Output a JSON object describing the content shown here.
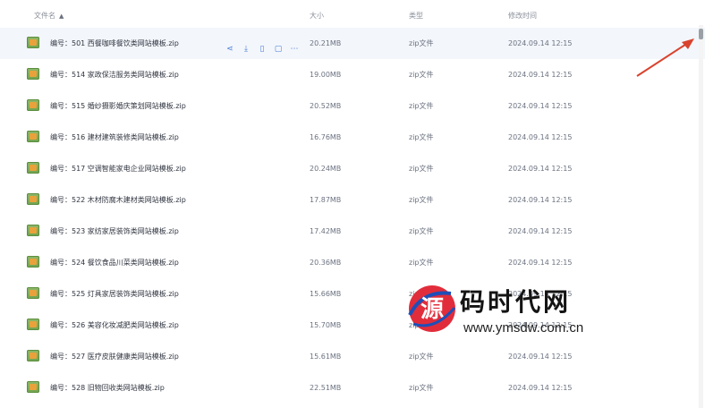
{
  "table": {
    "headers": {
      "name": "文件名",
      "size": "大小",
      "type": "类型",
      "time": "修改时间"
    },
    "rows": [
      {
        "name": "编号：501 西餐咖啡餐饮类网站模板.zip",
        "size": "20.21MB",
        "type": "zip文件",
        "time": "2024.09.14 12:15"
      },
      {
        "name": "编号：514 家政保洁服务类网站模板.zip",
        "size": "19.00MB",
        "type": "zip文件",
        "time": "2024.09.14 12:15"
      },
      {
        "name": "编号：515 婚纱摄影婚庆策划网站模板.zip",
        "size": "20.52MB",
        "type": "zip文件",
        "time": "2024.09.14 12:15"
      },
      {
        "name": "编号：516 建材建筑装修类网站模板.zip",
        "size": "16.76MB",
        "type": "zip文件",
        "time": "2024.09.14 12:15"
      },
      {
        "name": "编号：517 空调智能家电企业网站模板.zip",
        "size": "20.24MB",
        "type": "zip文件",
        "time": "2024.09.14 12:15"
      },
      {
        "name": "编号：522 木材防腐木建材类网站模板.zip",
        "size": "17.87MB",
        "type": "zip文件",
        "time": "2024.09.14 12:15"
      },
      {
        "name": "编号：523 家纺家居装饰类网站模板.zip",
        "size": "17.42MB",
        "type": "zip文件",
        "time": "2024.09.14 12:15"
      },
      {
        "name": "编号：524 餐饮食品川菜类网站模板.zip",
        "size": "20.36MB",
        "type": "zip文件",
        "time": "2024.09.14 12:15"
      },
      {
        "name": "编号：525 灯具家居装饰类网站模板.zip",
        "size": "15.66MB",
        "type": "zip文件",
        "time": "2024.09.14 12:15"
      },
      {
        "name": "编号：526 美容化妆减肥类网站模板.zip",
        "size": "15.70MB",
        "type": "zip文件",
        "time": "2024.09.14 12:15"
      },
      {
        "name": "编号：527 医疗皮肤健康类网站模板.zip",
        "size": "15.61MB",
        "type": "zip文件",
        "time": "2024.09.14 12:15"
      },
      {
        "name": "编号：528 旧物回收类网站模板.zip",
        "size": "22.51MB",
        "type": "zip文件",
        "time": "2024.09.14 12:15"
      }
    ]
  },
  "row_actions": [
    "share-icon",
    "download-icon",
    "delete-icon",
    "copy-icon",
    "more-icon"
  ],
  "watermark": {
    "logo_char": "源",
    "text": "码时代网",
    "url": "www.ymsdw.com.cn"
  },
  "colors": {
    "accent": "#4a7fd6",
    "arrow": "#d9432e",
    "active_row": "#f3f6fb"
  }
}
